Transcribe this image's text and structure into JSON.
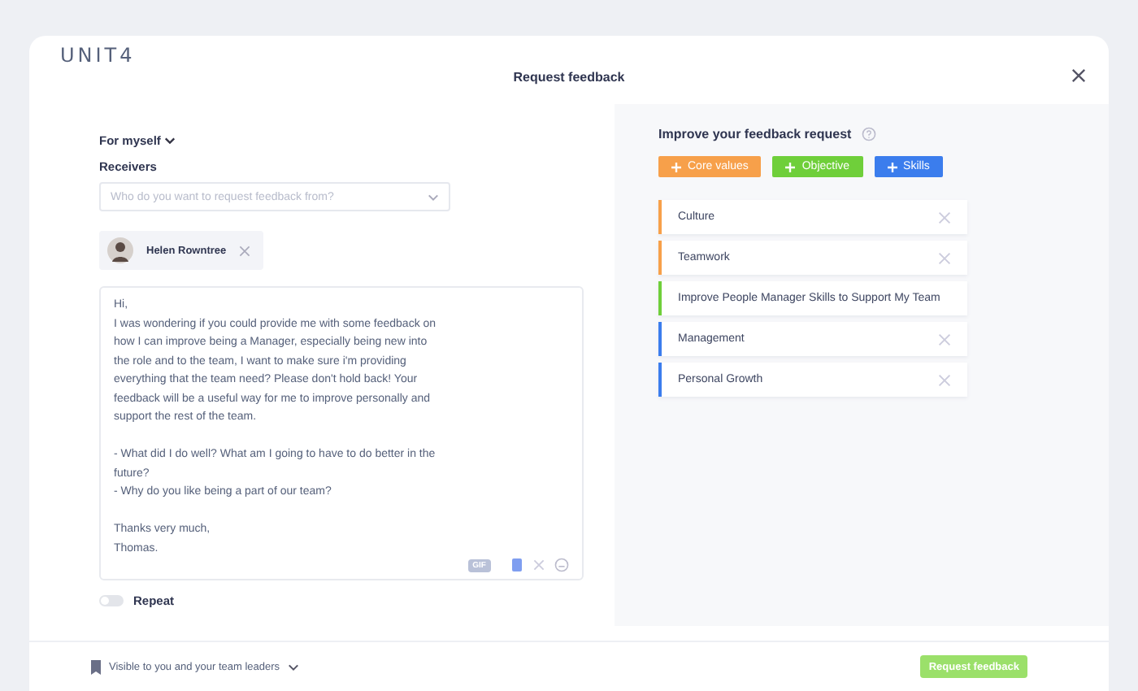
{
  "brand": "UNIT4",
  "window": {
    "title": "Request feedback"
  },
  "form": {
    "mode": "For myself",
    "receivers_label": "Receivers",
    "receivers_field": {
      "placeholder": "Who do you want to request feedback from?"
    },
    "receivers": [
      {
        "name": "Helen Rowntree"
      }
    ],
    "message": "Hi,\nI was wondering if you could provide me with some feedback on how I can improve being a Manager, especially being new into the role and to the team, I want to make sure i'm providing everything that the team need? Please don't hold back! Your feedback will be a useful way for me to improve personally and support the rest of the team.\n\n- What did I do well? What am I going to have to do better in the future?\n- Why do you like being a part of our team?\n\nThanks very much,\nThomas.",
    "gif_label": "GIF",
    "repeat": {
      "label": "Repeat",
      "on": false
    }
  },
  "improve": {
    "title": "Improve your feedback request",
    "add_buttons": [
      {
        "label": "Core values",
        "color": "#f7a04a"
      },
      {
        "label": "Objective",
        "color": "#6fcf3a"
      },
      {
        "label": "Skills",
        "color": "#3b7ded"
      }
    ],
    "items": [
      {
        "label": "Culture",
        "color": "#f7a04a",
        "removable": true
      },
      {
        "label": "Teamwork",
        "color": "#f7a04a",
        "removable": true
      },
      {
        "label": "Improve People Manager Skills to Support My Team",
        "color": "#6fcf3a",
        "removable": false
      },
      {
        "label": "Management",
        "color": "#3b7ded",
        "removable": true
      },
      {
        "label": "Personal Growth",
        "color": "#3b7ded",
        "removable": true
      }
    ]
  },
  "footer": {
    "visibility": "Visible to you and your team leaders",
    "submit": {
      "label": "Request feedback",
      "disabled": true
    }
  }
}
